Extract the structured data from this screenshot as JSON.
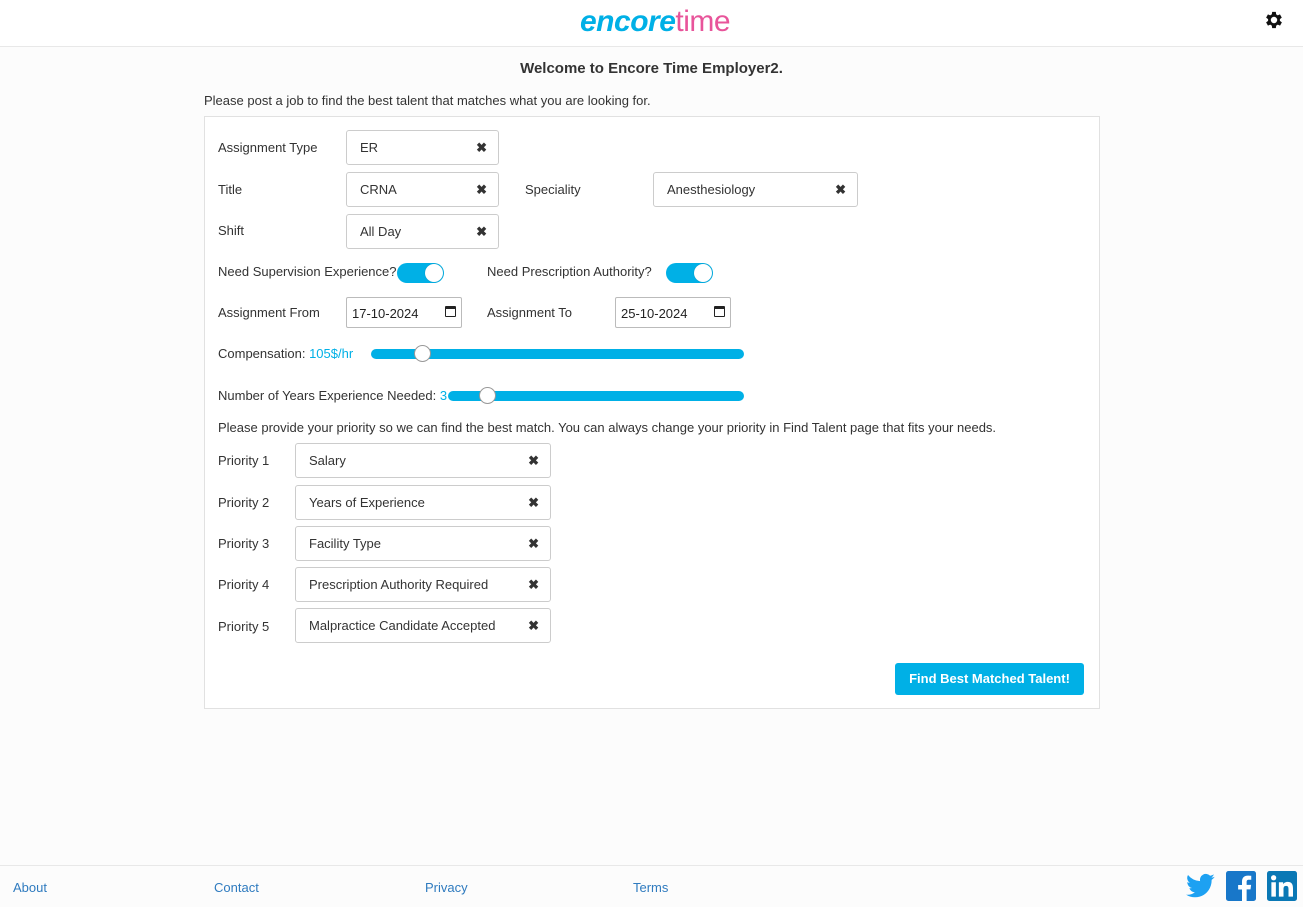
{
  "header": {
    "logo_encore": "encore",
    "logo_time": "time"
  },
  "welcome": "Welcome to Encore Time Employer2.",
  "intro": "Please post a job to find the best talent that matches what you are looking for.",
  "form": {
    "assignment_type_label": "Assignment Type",
    "assignment_type_value": "ER",
    "title_label": "Title",
    "title_value": "CRNA",
    "speciality_label": "Speciality",
    "speciality_value": "Anesthesiology",
    "shift_label": "Shift",
    "shift_value": "All Day",
    "supervision_label": "Need Supervision Experience?",
    "supervision_on": true,
    "prescription_label": "Need Prescription Authority?",
    "prescription_on": true,
    "from_label": "Assignment From",
    "from_value": "17-10-2024",
    "to_label": "Assignment To",
    "to_value": "25-10-2024",
    "compensation_label": "Compensation:",
    "compensation_value": "105$/hr",
    "compensation_fraction": 0.12,
    "experience_label": "Number of Years Experience Needed:",
    "experience_value": "3",
    "experience_fraction": 0.11,
    "priority_intro": "Please provide your priority so we can find the best match. You can always change your priority in Find Talent page that fits your needs.",
    "priorities": [
      {
        "label": "Priority 1",
        "value": "Salary"
      },
      {
        "label": "Priority 2",
        "value": "Years of Experience"
      },
      {
        "label": "Priority 3",
        "value": "Facility Type"
      },
      {
        "label": "Priority 4",
        "value": "Prescription Authority Required"
      },
      {
        "label": "Priority 5",
        "value": "Malpractice Candidate Accepted"
      }
    ],
    "clear_icon": "✖",
    "submit_label": "Find Best Matched Talent!"
  },
  "footer": {
    "about": "About",
    "contact": "Contact",
    "privacy": "Privacy",
    "terms": "Terms"
  },
  "colors": {
    "accent": "#00b0e6",
    "logo_pink": "#e8549a",
    "link": "#2f7bbf"
  },
  "icons": [
    "gear-icon",
    "twitter-icon",
    "facebook-icon",
    "linkedin-icon",
    "calendar-icon",
    "clear-icon"
  ]
}
